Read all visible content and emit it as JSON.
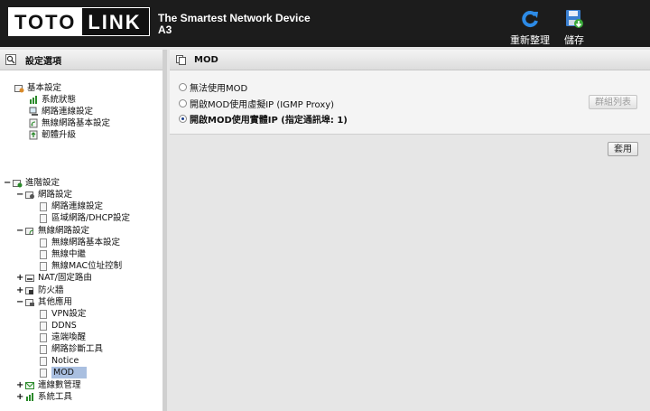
{
  "header": {
    "logo_left": "TOTO",
    "logo_right": "LINK",
    "tagline": "The Smartest Network Device",
    "model": "A3",
    "refresh_label": "重新整理",
    "save_label": "儲存"
  },
  "sidebar": {
    "title": "設定選項",
    "basic": {
      "label": "基本設定",
      "items": [
        "系統狀態",
        "網路連線設定",
        "無線網路基本設定",
        "韌體升級"
      ]
    },
    "advanced": {
      "toggle": "−",
      "label": "進階設定",
      "network": {
        "toggle": "−",
        "label": "網路設定",
        "items": [
          "網路連線設定",
          "區域網路/DHCP設定"
        ]
      },
      "wireless": {
        "toggle": "−",
        "label": "無線網路設定",
        "items": [
          "無線網路基本設定",
          "無線中繼",
          "無線MAC位址控制"
        ]
      },
      "nat": {
        "toggle": "+",
        "label": "NAT/固定路由"
      },
      "firewall": {
        "toggle": "+",
        "label": "防火牆"
      },
      "other": {
        "toggle": "−",
        "label": "其他應用",
        "items": [
          "VPN設定",
          "DDNS",
          "遠端喚醒",
          "網路診斷工具",
          "Notice",
          "MOD"
        ]
      },
      "connmgmt": {
        "toggle": "+",
        "label": "連線數管理"
      },
      "systools": {
        "toggle": "+",
        "label": "系統工具"
      }
    }
  },
  "main": {
    "title": "MOD",
    "options": [
      {
        "label": "無法使用MOD",
        "checked": false
      },
      {
        "label": "開啟MOD使用虛擬IP (IGMP Proxy)",
        "checked": false
      },
      {
        "label": "開啟MOD使用實體IP (指定通訊埠: 1)",
        "checked": true
      }
    ],
    "group_list_label": "群組列表",
    "apply_label": "套用"
  },
  "colors": {
    "header_bg": "#1c1c1c",
    "selected_bg": "#a9bfe0",
    "icon_blue": "#1f7ad6"
  }
}
